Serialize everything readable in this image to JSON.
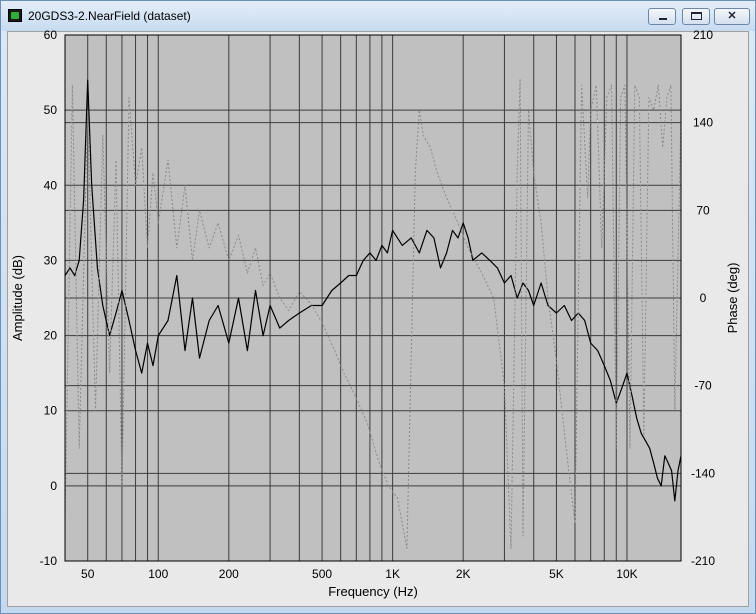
{
  "window": {
    "title": "20GDS3-2.NearField (dataset)",
    "icon": "app-icon",
    "controls": {
      "minimize": "minimize-icon",
      "maximize": "maximize-icon",
      "close": "close-icon"
    }
  },
  "colors": {
    "plot_background": "#c0c0c0",
    "grid": "#3c3c3c",
    "amplitude_line": "#000000",
    "phase_line": "#8a8a8a"
  },
  "chart_data": {
    "type": "line",
    "xlabel": "Frequency (Hz)",
    "ylabel": "Amplitude (dB)",
    "y2label": "Phase (deg)",
    "x_scale": "log",
    "xlim": [
      40,
      17000
    ],
    "ylim": [
      -10,
      60
    ],
    "y2lim": [
      -210,
      210
    ],
    "grid": true,
    "x_ticks": [
      {
        "value": 50,
        "label": "50"
      },
      {
        "value": 100,
        "label": "100"
      },
      {
        "value": 200,
        "label": "200"
      },
      {
        "value": 500,
        "label": "500"
      },
      {
        "value": 1000,
        "label": "1K"
      },
      {
        "value": 2000,
        "label": "2K"
      },
      {
        "value": 5000,
        "label": "5K"
      },
      {
        "value": 10000,
        "label": "10K"
      }
    ],
    "y_ticks": [
      60,
      50,
      40,
      30,
      20,
      10,
      0,
      -10
    ],
    "y2_ticks": [
      210,
      140,
      70,
      0,
      -70,
      -140,
      -210
    ],
    "series": [
      {
        "axis": "left",
        "style": "solid",
        "x": [
          40,
          42,
          44,
          46,
          48,
          50,
          52,
          55,
          58,
          62,
          66,
          70,
          75,
          80,
          85,
          90,
          95,
          100,
          110,
          120,
          130,
          140,
          150,
          165,
          180,
          200,
          220,
          240,
          260,
          280,
          300,
          330,
          360,
          400,
          450,
          500,
          550,
          600,
          650,
          700,
          750,
          800,
          850,
          900,
          950,
          1000,
          1100,
          1200,
          1300,
          1400,
          1500,
          1600,
          1700,
          1800,
          1900,
          2000,
          2100,
          2200,
          2400,
          2600,
          2800,
          3000,
          3200,
          3400,
          3600,
          3800,
          4000,
          4300,
          4600,
          5000,
          5400,
          5800,
          6200,
          6600,
          7000,
          7500,
          8000,
          8500,
          9000,
          9500,
          10000,
          10500,
          11000,
          11500,
          12000,
          12500,
          13000,
          13500,
          14000,
          14500,
          15000,
          15500,
          16000,
          16500,
          17000
        ],
        "y": [
          28,
          29,
          28,
          30,
          38,
          54,
          40,
          29,
          24,
          20,
          23,
          26,
          22,
          18,
          15,
          19,
          16,
          20,
          22,
          28,
          18,
          25,
          17,
          22,
          24,
          19,
          25,
          18,
          26,
          20,
          24,
          21,
          22,
          23,
          24,
          24,
          26,
          27,
          28,
          28,
          30,
          31,
          30,
          32,
          31,
          34,
          32,
          33,
          31,
          34,
          33,
          29,
          31,
          34,
          33,
          35,
          33,
          30,
          31,
          30,
          29,
          27,
          28,
          25,
          27,
          26,
          24,
          27,
          24,
          23,
          24,
          22,
          23,
          22,
          19,
          18,
          16,
          14,
          11,
          13,
          15,
          12,
          9,
          7,
          6,
          5,
          3,
          1,
          0,
          4,
          3,
          2,
          -2,
          2,
          4
        ]
      },
      {
        "axis": "right",
        "style": "dotted",
        "x": [
          40,
          43,
          46,
          50,
          54,
          58,
          62,
          66,
          70,
          75,
          80,
          85,
          90,
          95,
          100,
          110,
          120,
          130,
          140,
          150,
          165,
          180,
          200,
          220,
          240,
          260,
          280,
          300,
          330,
          360,
          400,
          450,
          500,
          560,
          620,
          700,
          780,
          870,
          960,
          1050,
          1150,
          1250,
          1300,
          1350,
          1450,
          1550,
          1700,
          1900,
          2100,
          2400,
          2700,
          3000,
          3200,
          3400,
          3500,
          3600,
          3800,
          4000,
          4300,
          4600,
          5000,
          5500,
          6000,
          6400,
          6800,
          7000,
          7400,
          7800,
          8200,
          8600,
          9000,
          9400,
          9800,
          10300,
          10800,
          11300,
          11800,
          12400,
          13000,
          13600,
          14200,
          14800,
          15400,
          16000,
          17000
        ],
        "y": [
          -180,
          170,
          -120,
          150,
          -90,
          130,
          -60,
          110,
          -150,
          160,
          90,
          120,
          40,
          100,
          60,
          110,
          40,
          90,
          30,
          70,
          40,
          60,
          30,
          50,
          20,
          40,
          10,
          20,
          0,
          -10,
          5,
          -5,
          -20,
          -40,
          -60,
          -80,
          -100,
          -130,
          -150,
          -160,
          -200,
          100,
          150,
          130,
          120,
          100,
          80,
          60,
          40,
          20,
          0,
          -70,
          -200,
          100,
          175,
          -190,
          150,
          100,
          60,
          0,
          -50,
          -120,
          -180,
          170,
          80,
          150,
          170,
          40,
          160,
          170,
          -120,
          160,
          170,
          -120,
          170,
          160,
          -110,
          160,
          150,
          170,
          120,
          160,
          170,
          -90,
          150
        ]
      }
    ]
  }
}
